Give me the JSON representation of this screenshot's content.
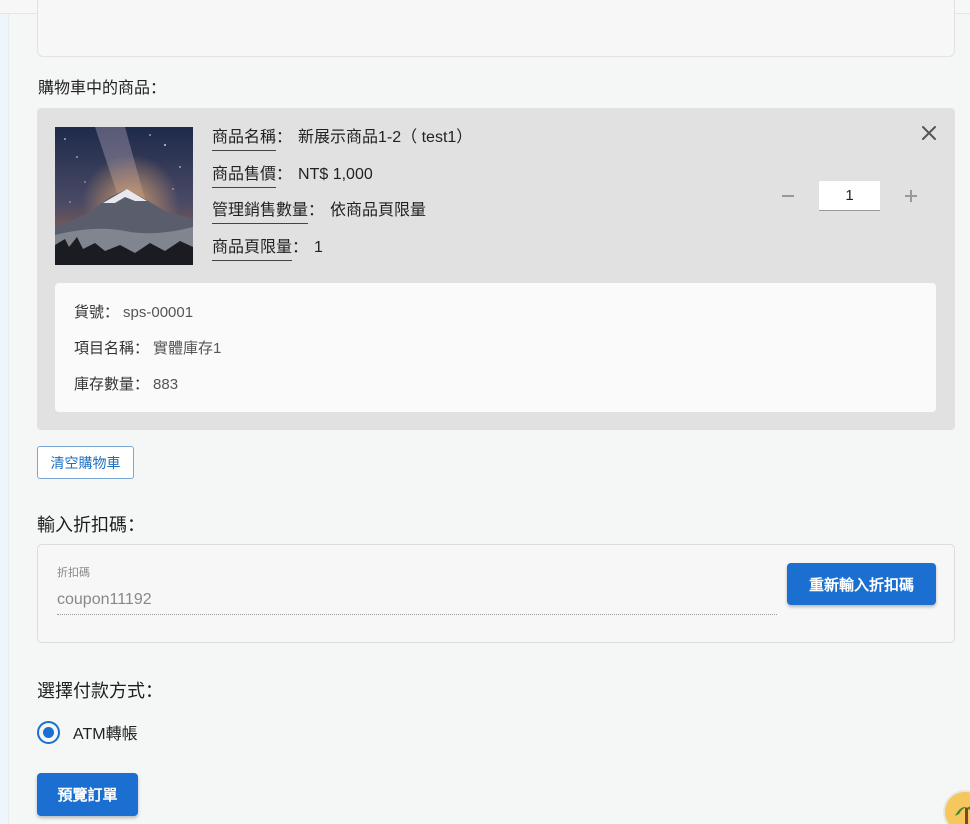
{
  "cart": {
    "section_label": "購物車中的商品：",
    "item": {
      "name_key": "商品名稱",
      "name_value": "新展示商品1-2（ test1）",
      "price_key": "商品售價",
      "price_value": "NT$ 1,000",
      "manage_key": "管理銷售數量",
      "manage_value": "依商品頁限量",
      "limit_key": "商品頁限量",
      "limit_value": "1",
      "separator": "：",
      "quantity": "1",
      "close_icon": "close-icon",
      "minus_icon": "minus-icon",
      "plus_icon": "plus-icon"
    },
    "stock": {
      "sku_key": "貨號：",
      "sku_value": "sps-00001",
      "item_key": "項目名稱：",
      "item_value": "實體庫存1",
      "qty_key": "庫存數量：",
      "qty_value": "883"
    },
    "clear_button": "清空購物車"
  },
  "coupon": {
    "title": "輸入折扣碼：",
    "field_label": "折扣碼",
    "field_value": "coupon11192",
    "reenter_button": "重新輸入折扣碼"
  },
  "payment": {
    "title": "選擇付款方式：",
    "option_label": "ATM轉帳",
    "selected": true
  },
  "preview_button": "預覽訂單",
  "colors": {
    "primary": "#1a6fd0",
    "card_bg": "#e1e1e1",
    "page_bg": "#f5f6f6"
  }
}
